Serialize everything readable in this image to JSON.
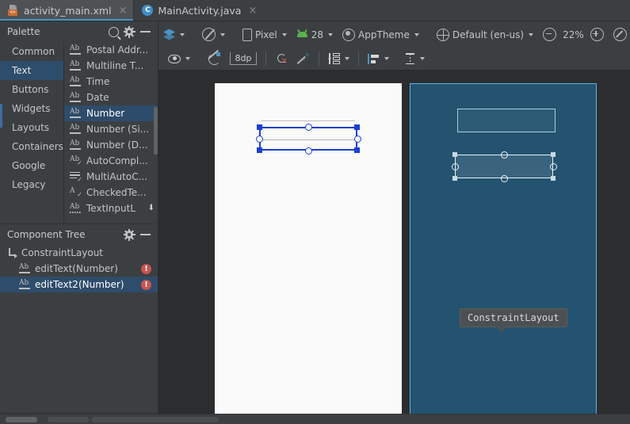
{
  "tabs": [
    {
      "label": "activity_main.xml",
      "icon": "xml-file-icon",
      "active": true,
      "close": "×"
    },
    {
      "label": "MainActivity.java",
      "icon": "java-class-icon",
      "active": false,
      "close": "×"
    }
  ],
  "toolbar_primary": {
    "design_mode": {
      "icon": "layers-icon",
      "label": ""
    },
    "orientation": {
      "icon": "rotate-icon",
      "label": ""
    },
    "device": {
      "icon": "phone-icon",
      "label": "Pixel"
    },
    "api_level": {
      "icon": "android-icon",
      "label": "28"
    },
    "theme": {
      "icon": "theme-icon",
      "label": "AppTheme"
    },
    "locale": {
      "icon": "globe-icon",
      "label": "Default (en-us)"
    },
    "zoom_out": "zoom-out-icon",
    "zoom_level": "22%",
    "zoom_in": "zoom-in-icon",
    "zoom_fit": "zoom-fit-icon",
    "error_badge": "!"
  },
  "toolbar_secondary": {
    "visibility": {
      "icon": "eye-icon",
      "label": ""
    },
    "clear_constraints_toggle": {
      "icon": "autoconnect-off-icon",
      "label": ""
    },
    "default_margin": "8dp",
    "clear_all_constraints": {
      "icon": "clear-constraints-icon",
      "label": ""
    },
    "infer_constraints": {
      "icon": "magic-wand-icon",
      "label": ""
    },
    "pack": {
      "icon": "pack-icon",
      "label": ""
    },
    "align": {
      "icon": "align-icon",
      "label": ""
    },
    "guidelines": {
      "icon": "guideline-icon",
      "label": ""
    }
  },
  "palette": {
    "title": "Palette",
    "actions": {
      "search": "search-icon",
      "settings": "gear-icon",
      "minimize": "minimize-icon"
    },
    "categories": [
      {
        "label": "Common",
        "selected": false
      },
      {
        "label": "Text",
        "selected": true
      },
      {
        "label": "Buttons",
        "selected": false
      },
      {
        "label": "Widgets",
        "selected": false
      },
      {
        "label": "Layouts",
        "selected": false
      },
      {
        "label": "Containers",
        "selected": false
      },
      {
        "label": "Google",
        "selected": false
      },
      {
        "label": "Legacy",
        "selected": false
      }
    ],
    "items": [
      {
        "label": "Postal Addr...",
        "icon": "ab-underline-icon",
        "selected": false
      },
      {
        "label": "Multiline T...",
        "icon": "ab-underline-icon",
        "selected": false
      },
      {
        "label": "Time",
        "icon": "ab-underline-icon",
        "selected": false
      },
      {
        "label": "Date",
        "icon": "ab-underline-icon",
        "selected": false
      },
      {
        "label": "Number",
        "icon": "ab-underline-icon",
        "selected": true
      },
      {
        "label": "Number (Si...",
        "icon": "ab-underline-icon",
        "selected": false
      },
      {
        "label": "Number (D...",
        "icon": "ab-underline-icon",
        "selected": false
      },
      {
        "label": "AutoCompl...",
        "icon": "ab-check-icon",
        "selected": false
      },
      {
        "label": "MultiAutoC...",
        "icon": "lines-check-icon",
        "selected": false
      },
      {
        "label": "CheckedTe...",
        "icon": "a-check-icon",
        "selected": false
      },
      {
        "label": "TextInputL",
        "icon": "ab-dotted-icon",
        "selected": false,
        "trailing_icon": "download-icon"
      }
    ]
  },
  "component_tree": {
    "title": "Component Tree",
    "actions": {
      "settings": "gear-icon",
      "minimize": "minimize-icon"
    },
    "nodes": [
      {
        "label": "ConstraintLayout",
        "icon": "constraintlayout-icon",
        "indent": 0,
        "selected": false,
        "error": false
      },
      {
        "label": "editText(Number)",
        "icon": "ab-underline-icon",
        "indent": 1,
        "selected": false,
        "error": true,
        "error_glyph": "!"
      },
      {
        "label": "editText2(Number)",
        "icon": "ab-underline-icon",
        "indent": 1,
        "selected": true,
        "error": true,
        "error_glyph": "!"
      }
    ]
  },
  "canvas": {
    "design_surface": {
      "name": "design-preview",
      "background": "#fafafa"
    },
    "blueprint_surface": {
      "name": "blueprint-preview",
      "background": "#24536f",
      "border": "#63b0e0"
    },
    "selection_color": "#1b3fd4",
    "tooltip": {
      "text": "ConstraintLayout"
    }
  }
}
